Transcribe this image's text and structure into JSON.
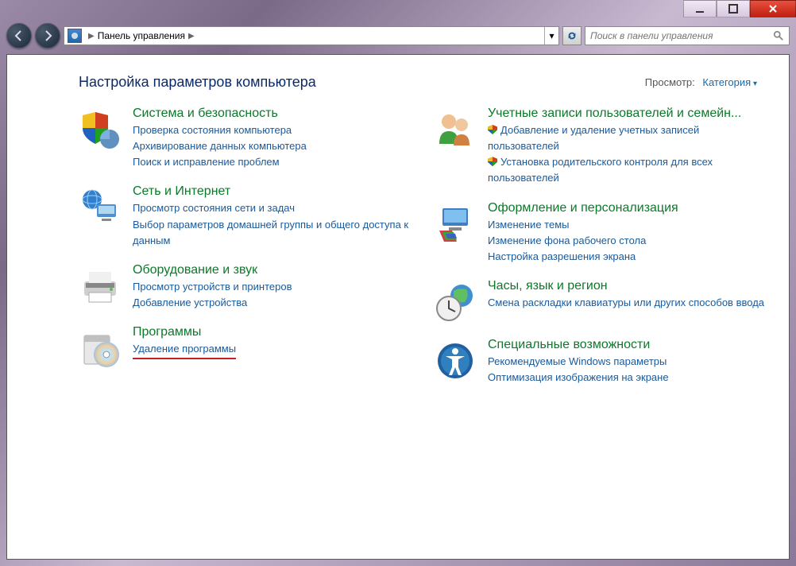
{
  "breadcrumb": {
    "label": "Панель управления"
  },
  "search": {
    "placeholder": "Поиск в панели управления"
  },
  "header": {
    "title": "Настройка параметров компьютера"
  },
  "viewby": {
    "label": "Просмотр:",
    "value": "Категория"
  },
  "left": [
    {
      "title": "Система и безопасность",
      "links": [
        "Проверка состояния компьютера",
        "Архивирование данных компьютера",
        "Поиск и исправление проблем"
      ]
    },
    {
      "title": "Сеть и Интернет",
      "links": [
        "Просмотр состояния сети и задач",
        "Выбор параметров домашней группы и общего доступа к данным"
      ]
    },
    {
      "title": "Оборудование и звук",
      "links": [
        "Просмотр устройств и принтеров",
        "Добавление устройства"
      ]
    },
    {
      "title": "Программы",
      "links": [
        "Удаление программы"
      ]
    }
  ],
  "right": [
    {
      "title": "Учетные записи пользователей и семейн...",
      "links": [
        "Добавление и удаление учетных записей пользователей",
        "Установка родительского контроля для всех пользователей"
      ],
      "shield": true
    },
    {
      "title": "Оформление и персонализация",
      "links": [
        "Изменение темы",
        "Изменение фона рабочего стола",
        "Настройка разрешения экрана"
      ]
    },
    {
      "title": "Часы, язык и регион",
      "links": [
        "Смена раскладки клавиатуры или других способов ввода"
      ]
    },
    {
      "title": "Специальные возможности",
      "links": [
        "Рекомендуемые Windows параметры",
        "Оптимизация изображения на экране"
      ]
    }
  ]
}
